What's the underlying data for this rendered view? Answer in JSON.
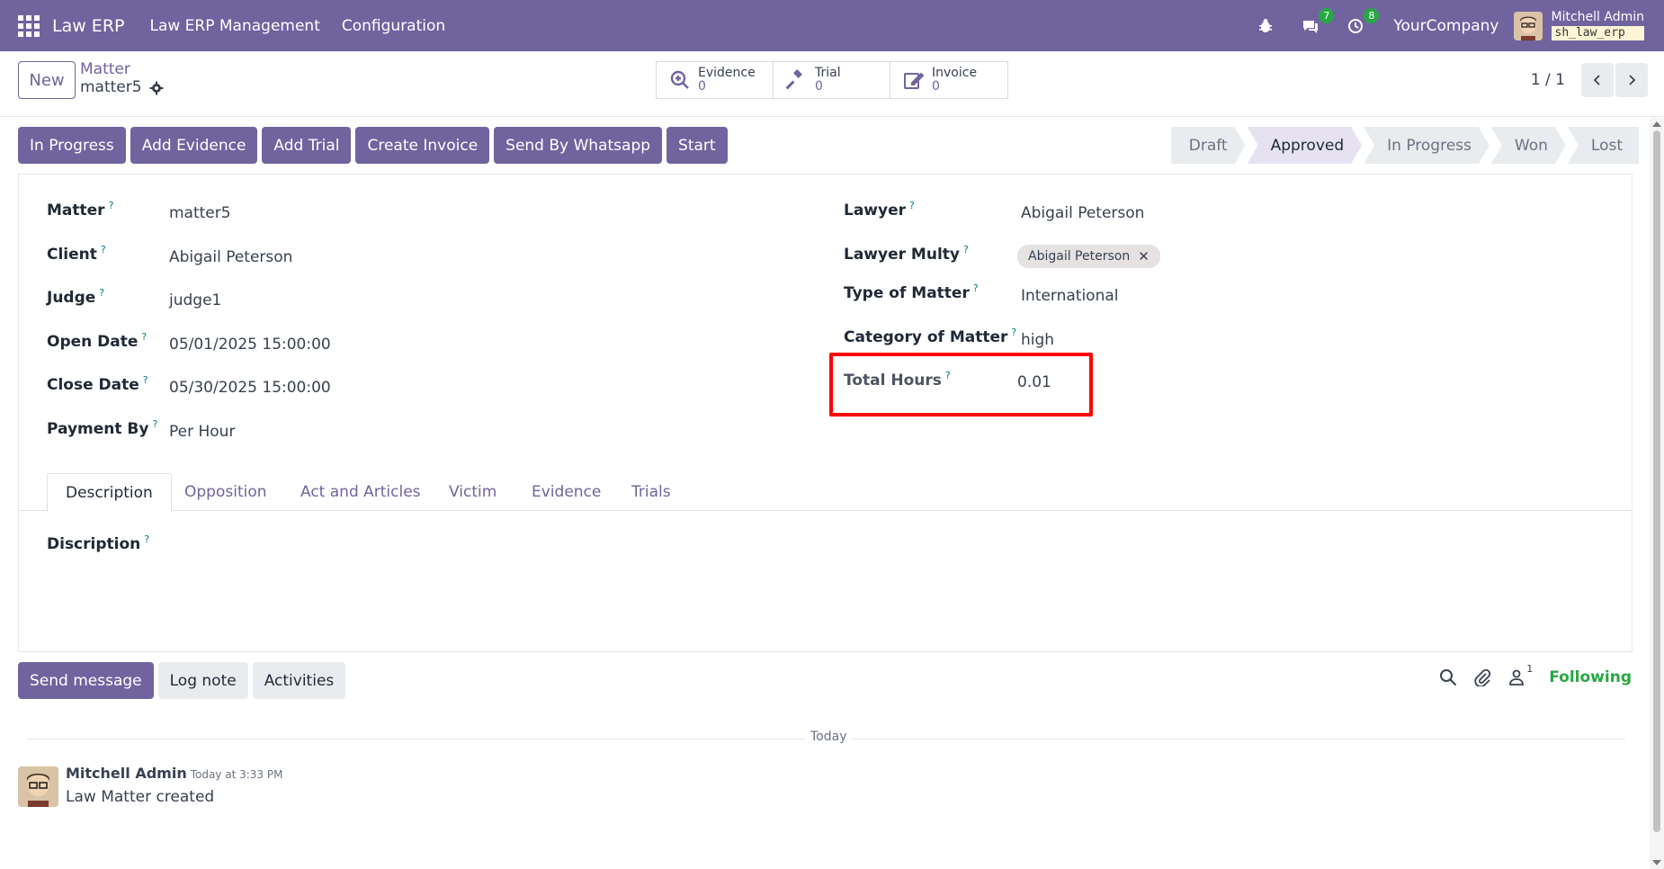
{
  "navbar": {
    "brand": "Law ERP",
    "menus": [
      "Law ERP Management",
      "Configuration"
    ],
    "messages_count": "7",
    "activities_count": "8",
    "company": "YourCompany",
    "user_name": "Mitchell Admin",
    "db_name": "sh_law_erp"
  },
  "control_panel": {
    "new_label": "New",
    "breadcrumb_parent": "Matter",
    "breadcrumb_current": "matter5",
    "smart_buttons": [
      {
        "label": "Evidence",
        "count": "0",
        "icon": "magnify-icon"
      },
      {
        "label": "Trial",
        "count": "0",
        "icon": "gavel-icon"
      },
      {
        "label": "Invoice",
        "count": "0",
        "icon": "edit-icon"
      }
    ],
    "pager": "1 / 1"
  },
  "actions": [
    "In Progress",
    "Add Evidence",
    "Add Trial",
    "Create Invoice",
    "Send By Whatsapp",
    "Start"
  ],
  "stages": [
    {
      "label": "Draft",
      "active": false
    },
    {
      "label": "Approved",
      "active": true
    },
    {
      "label": "In Progress",
      "active": false
    },
    {
      "label": "Won",
      "active": false
    },
    {
      "label": "Lost",
      "active": false
    }
  ],
  "form": {
    "left": [
      {
        "label": "Matter",
        "value": "matter5"
      },
      {
        "label": "Client",
        "value": "Abigail Peterson"
      },
      {
        "label": "Judge",
        "value": "judge1"
      },
      {
        "label": "Open Date",
        "value": "05/01/2025 15:00:00"
      },
      {
        "label": "Close Date",
        "value": "05/30/2025 15:00:00"
      },
      {
        "label": "Payment By",
        "value": "Per Hour"
      }
    ],
    "right": {
      "lawyer_label": "Lawyer",
      "lawyer_value": "Abigail Peterson",
      "lawyer_multy_label": "Lawyer Multy",
      "lawyer_multy_tag": "Abigail Peterson",
      "type_label": "Type of Matter",
      "type_value": "International",
      "category_label": "Category of Matter",
      "category_value": "high",
      "total_hours_label": "Total Hours",
      "total_hours_value": "0.01"
    },
    "help_mark": "?",
    "tabs": [
      "Description",
      "Opposition",
      "Act and Articles",
      "Victim",
      "Evidence",
      "Trials"
    ],
    "description_label": "Discription"
  },
  "chatter": {
    "send_message": "Send message",
    "log_note": "Log note",
    "activities": "Activities",
    "followers_count": "1",
    "following": "Following",
    "today": "Today",
    "message": {
      "author": "Mitchell Admin",
      "time": "Today at 3:33 PM",
      "body": "Law Matter created"
    }
  },
  "colors": {
    "brand": "#71639e",
    "highlight": "#ff0000",
    "following": "#28a745"
  }
}
